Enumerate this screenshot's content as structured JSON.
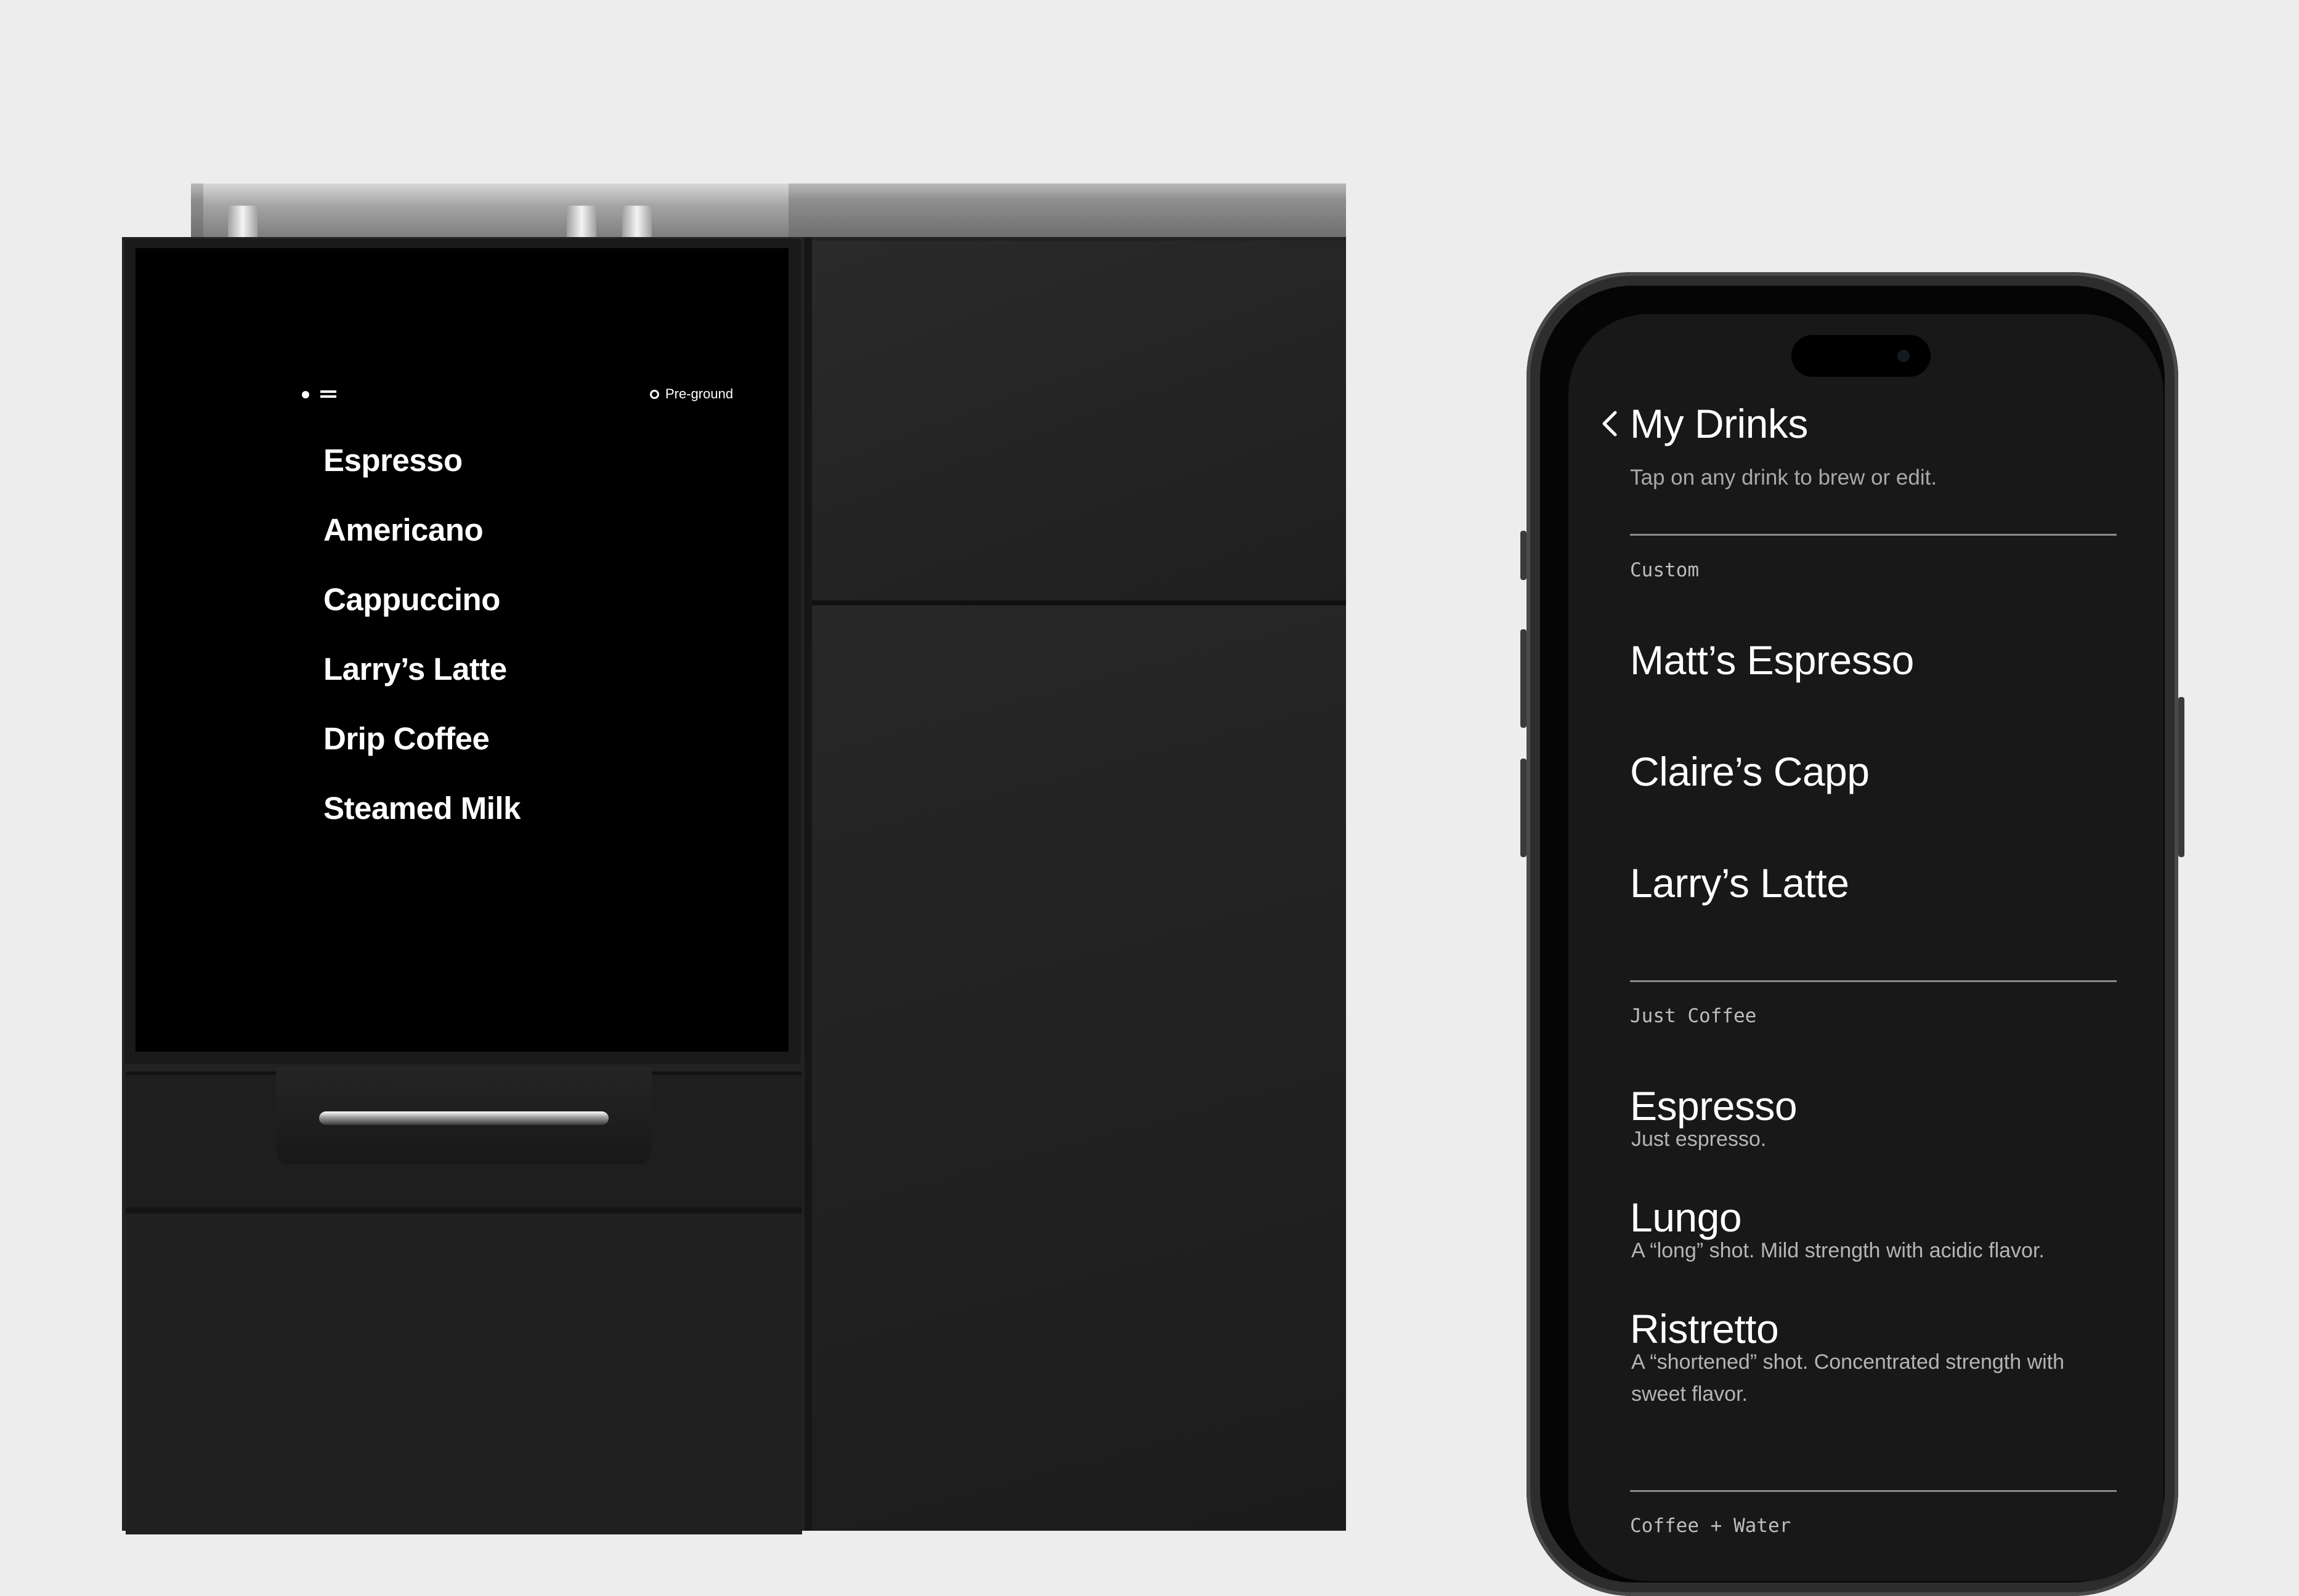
{
  "machine_screen": {
    "status": {
      "indicator_icon": "dot-icon",
      "menu_icon": "menu-icon",
      "grind_icon": "ring-icon",
      "grind_mode": "Pre-ground"
    },
    "menu": [
      "Espresso",
      "Americano",
      "Cappuccino",
      "Larry’s Latte",
      "Drip Coffee",
      "Steamed Milk"
    ]
  },
  "phone_app": {
    "back_icon": "chevron-left-icon",
    "title": "My Drinks",
    "subtitle": "Tap on any drink to brew or edit.",
    "sections": [
      {
        "label": "Custom",
        "drinks": [
          {
            "name": "Matt’s Espresso"
          },
          {
            "name": "Claire’s Capp"
          },
          {
            "name": "Larry’s Latte"
          }
        ]
      },
      {
        "label": "Just Coffee",
        "drinks": [
          {
            "name": "Espresso",
            "description": "Just espresso."
          },
          {
            "name": "Lungo",
            "description": "A “long” shot. Mild strength with acidic flavor."
          },
          {
            "name": "Ristretto",
            "description": "A “shortened” shot.  Concentrated strength with sweet flavor."
          }
        ]
      },
      {
        "label": "Coffee + Water",
        "drinks": []
      }
    ]
  },
  "colors": {
    "background": "#ededed",
    "machine_body": "#222222",
    "machine_screen": "#000000",
    "phone_screen": "#181818",
    "text_primary": "#ffffff",
    "text_secondary": "#a9a9a9"
  }
}
